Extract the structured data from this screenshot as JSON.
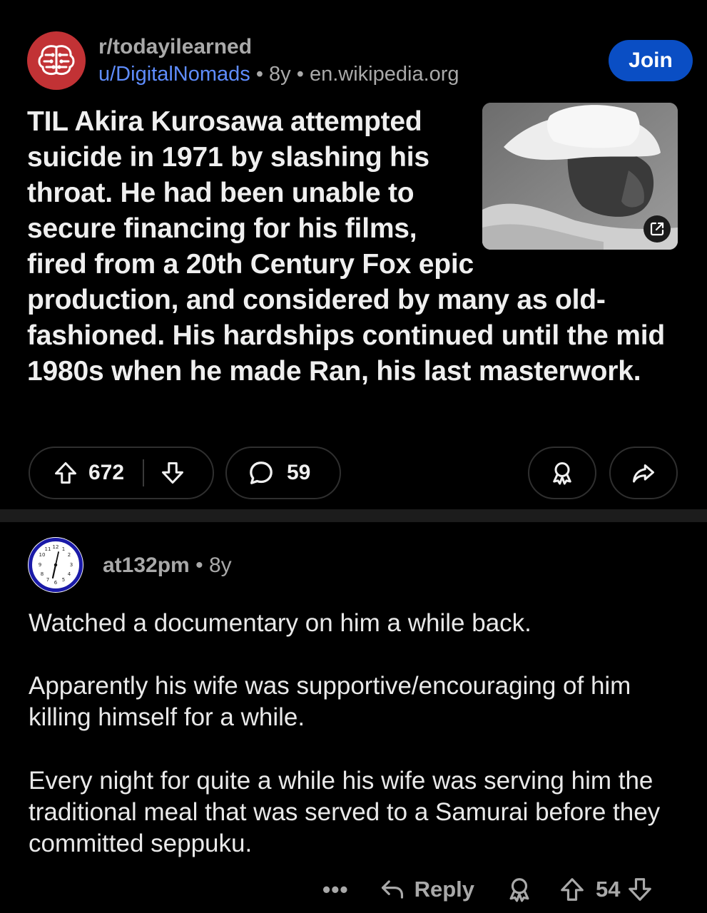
{
  "post": {
    "subreddit": "r/todayilearned",
    "author": "u/DigitalNomads",
    "age": "8y",
    "domain": "en.wikipedia.org",
    "separator": "•",
    "join_label": "Join",
    "title": "TIL Akira Kurosawa attempted suicide in 1971 by slashing his throat. He had been unable to secure financing for his films, fired from a 20th Century Fox epic production, and considered by many as old-fashioned. His hardships continued until the mid 1980s when he made Ran, his last masterwork.",
    "upvotes": "672",
    "comments": "59",
    "icons": {
      "subreddit": "brain-icon",
      "upvote": "arrow-up-icon",
      "downvote": "arrow-down-icon",
      "comment": "speech-bubble-icon",
      "award": "award-icon",
      "share": "share-icon",
      "external": "external-link-icon"
    }
  },
  "comment": {
    "author": "at132pm",
    "age": "8y",
    "separator": "•",
    "paragraphs": [
      "Watched a documentary on him a while back.",
      "Apparently his wife was supportive/encouraging of him killing himself for a while.",
      "Every night for quite a while his wife was serving him the traditional meal that was served to a Samurai before they committed seppuku."
    ],
    "more_label": "•••",
    "reply_label": "Reply",
    "score": "54"
  },
  "colors": {
    "background": "#000000",
    "join_button": "#0a4ec4",
    "username_link": "#5f8dff",
    "subreddit_avatar": "#c23235",
    "muted_text": "#a9a9a9"
  }
}
